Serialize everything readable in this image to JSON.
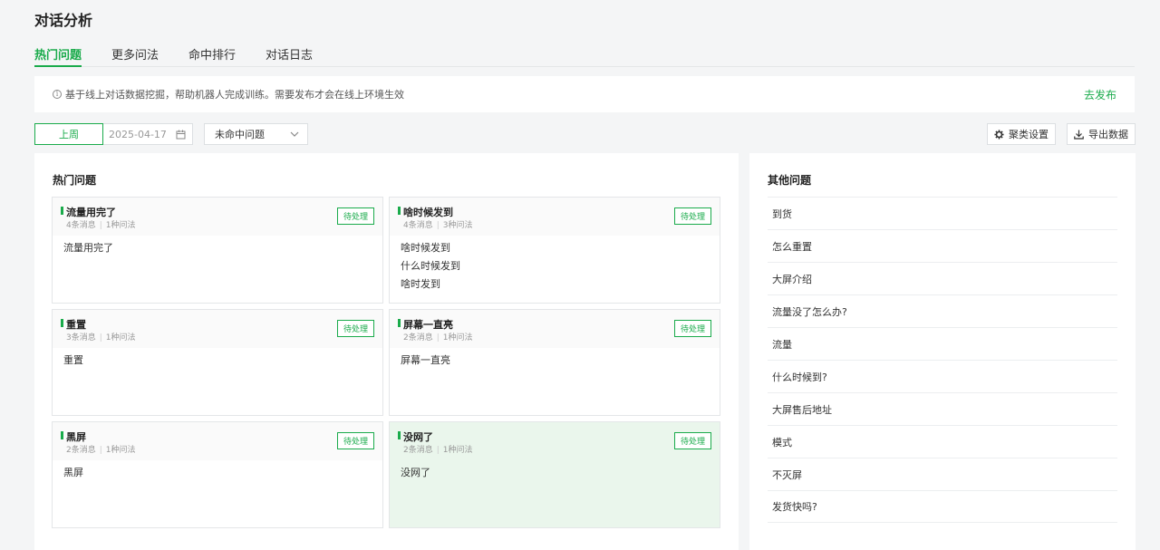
{
  "page": {
    "title": "对话分析"
  },
  "tabs": [
    {
      "label": "热门问题",
      "active": true
    },
    {
      "label": "更多问法",
      "active": false
    },
    {
      "label": "命中排行",
      "active": false
    },
    {
      "label": "对话日志",
      "active": false
    }
  ],
  "notice": {
    "text": "基于线上对话数据挖掘，帮助机器人完成训练。需要发布才会在线上环境生效",
    "link": "去发布",
    "icon": "info-icon"
  },
  "toolbar": {
    "range_button": "上周",
    "date": "2025-04-17",
    "filter_select": "未命中问题",
    "cluster_button": "聚类设置",
    "export_button": "导出数据"
  },
  "hot": {
    "title": "热门问题",
    "status_label": "待处理",
    "cards": [
      {
        "title": "流量用完了",
        "messages": "4条消息",
        "phrasings": "1种问法",
        "lines": [
          "流量用完了"
        ]
      },
      {
        "title": "啥时候发到",
        "messages": "4条消息",
        "phrasings": "3种问法",
        "lines": [
          "啥时候发到",
          "什么时候发到",
          "啥时发到"
        ]
      },
      {
        "title": "重置",
        "messages": "3条消息",
        "phrasings": "1种问法",
        "lines": [
          "重置"
        ]
      },
      {
        "title": "屏幕一直亮",
        "messages": "2条消息",
        "phrasings": "1种问法",
        "lines": [
          "屏幕一直亮"
        ]
      },
      {
        "title": "黑屏",
        "messages": "2条消息",
        "phrasings": "1种问法",
        "lines": [
          "黑屏"
        ]
      },
      {
        "title": "没网了",
        "messages": "2条消息",
        "phrasings": "1种问法",
        "lines": [
          "没网了"
        ],
        "highlighted": true
      }
    ]
  },
  "other": {
    "title": "其他问题",
    "items": [
      "到货",
      "怎么重置",
      "大屏介绍",
      "流量没了怎么办?",
      "流量",
      "什么时候到?",
      "大屏售后地址",
      "模式",
      "不灭屏",
      "发货快吗?"
    ]
  },
  "colors": {
    "accent": "#1aab4b",
    "highlight_bg": "#eaf6ec"
  }
}
